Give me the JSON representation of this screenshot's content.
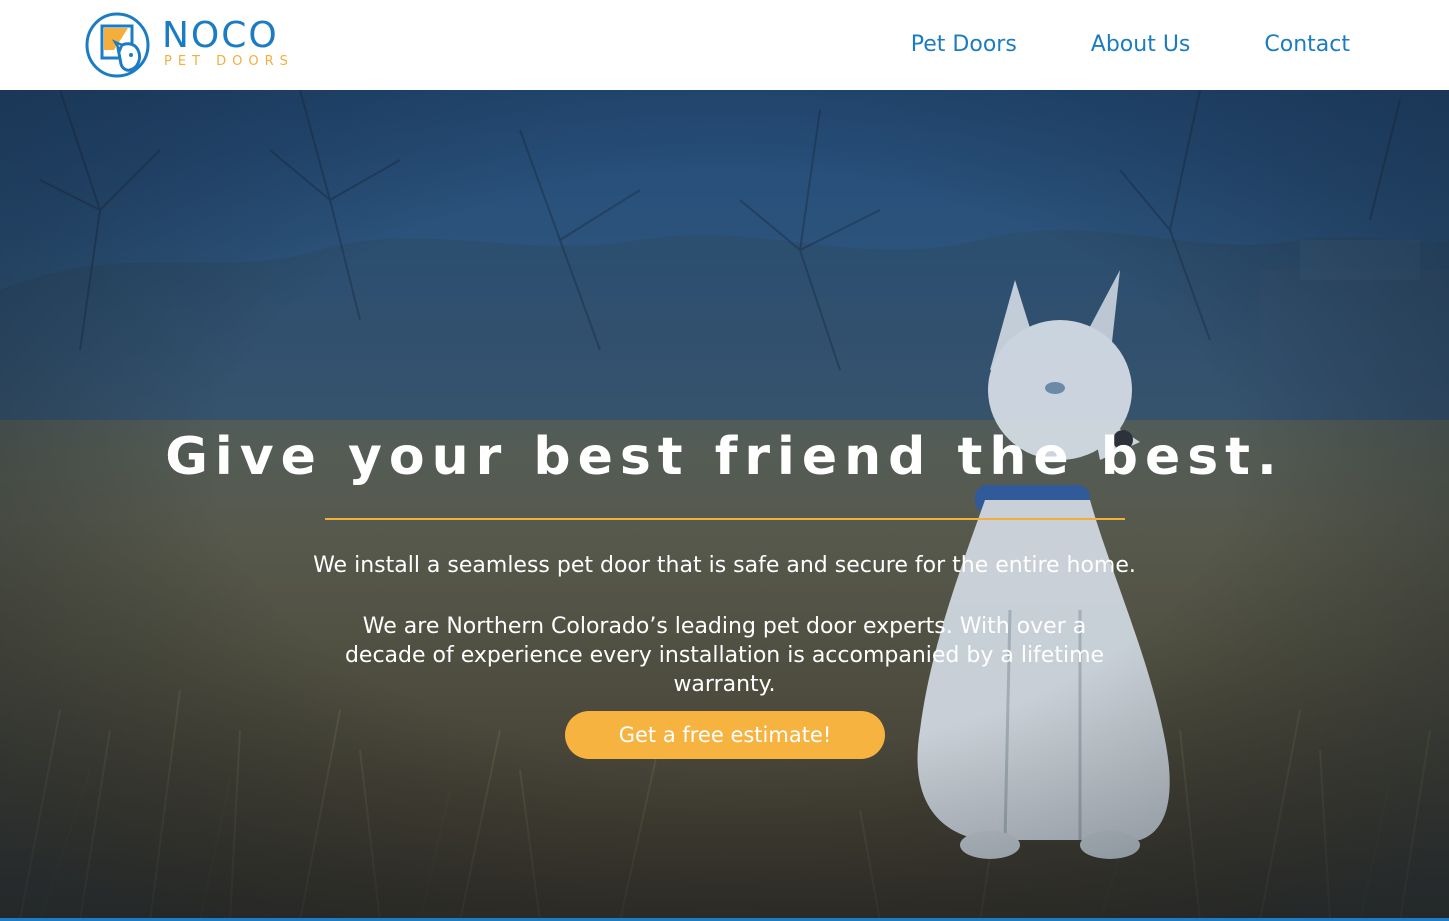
{
  "brand": {
    "name": "NOCO",
    "tagline": "PET DOORS",
    "icon": "pet-door-dog-logo",
    "colors": {
      "blue": "#1c7cc3",
      "gold": "#f5ae3b"
    }
  },
  "nav": {
    "items": [
      {
        "label": "Pet Doors"
      },
      {
        "label": "About Us"
      },
      {
        "label": "Contact"
      }
    ]
  },
  "hero": {
    "headline": "Give your best friend the best.",
    "lead": "We install a seamless pet door that is safe and secure for the entire home.",
    "body": "We are Northern Colorado’s leading pet door experts. With over a decade of experience every installation is accompanied by a lifetime warranty.",
    "cta_label": "Get a free estimate!",
    "cta_color": "#f7b340",
    "background": "husky-puppy-in-grass-photo"
  }
}
